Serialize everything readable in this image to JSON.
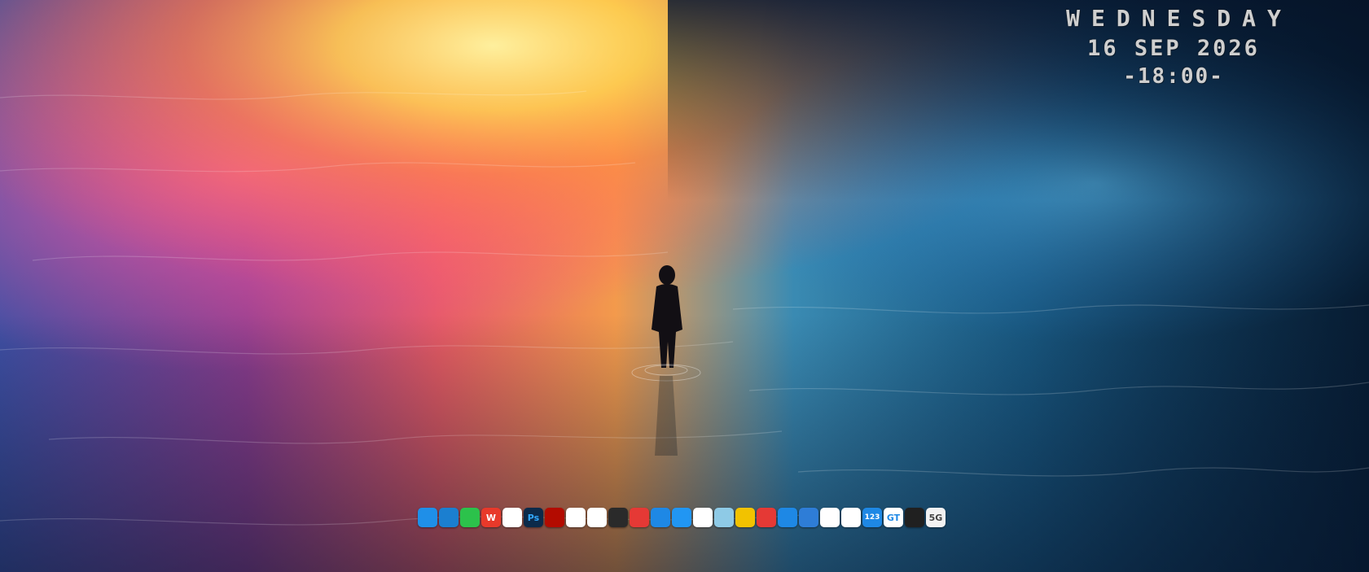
{
  "clock": {
    "day": "WEDNESDAY",
    "date": "16 SEP 2026",
    "time": "-18:00-"
  },
  "dock": {
    "icons": [
      {
        "name": "windows-start-icon",
        "glyph": "",
        "bg": "#1f8fe8",
        "fg": "#ffffff"
      },
      {
        "name": "edge-browser-icon",
        "glyph": "",
        "bg": "#1b7fd0",
        "fg": "#ffffff"
      },
      {
        "name": "wechat-icon",
        "glyph": "",
        "bg": "#2cc24b",
        "fg": "#ffffff"
      },
      {
        "name": "wps-office-icon",
        "glyph": "W",
        "bg": "#e8392a",
        "fg": "#ffffff"
      },
      {
        "name": "qq-penguin-icon",
        "glyph": "",
        "bg": "#ffffff",
        "fg": "#111111"
      },
      {
        "name": "photoshop-icon",
        "glyph": "Ps",
        "bg": "#0c2a4a",
        "fg": "#31a8ff"
      },
      {
        "name": "acrobat-pdf-icon",
        "glyph": "",
        "bg": "#b30b00",
        "fg": "#ffffff"
      },
      {
        "name": "vpn-shield-icon",
        "glyph": "",
        "bg": "#ffffff",
        "fg": "#1a3b7a"
      },
      {
        "name": "launcher-app-icon",
        "glyph": "",
        "bg": "#ffffff",
        "fg": "#111111"
      },
      {
        "name": "media-player-icon",
        "glyph": "",
        "bg": "#2a2a2a",
        "fg": "#f5a623"
      },
      {
        "name": "pdf-reader-icon",
        "glyph": "",
        "bg": "#e53935",
        "fg": "#ffffff"
      },
      {
        "name": "feishu-lark-icon",
        "glyph": "",
        "bg": "#1e88e5",
        "fg": "#ffffff"
      },
      {
        "name": "meta-infinity-icon",
        "glyph": "",
        "bg": "#2196f3",
        "fg": "#ffffff"
      },
      {
        "name": "bilibili-b-icon",
        "glyph": "",
        "bg": "#ffffff",
        "fg": "#111111"
      },
      {
        "name": "notepad-icon",
        "glyph": "",
        "bg": "#8ecae6",
        "fg": "#1d3557"
      },
      {
        "name": "music-note-icon",
        "glyph": "",
        "bg": "#f2c200",
        "fg": "#3a7d1e"
      },
      {
        "name": "netease-music-icon",
        "glyph": "",
        "bg": "#e53935",
        "fg": "#ffffff"
      },
      {
        "name": "refresh-arrow-icon",
        "glyph": "",
        "bg": "#1e88e5",
        "fg": "#ffffff"
      },
      {
        "name": "paper-plane-icon",
        "glyph": "",
        "bg": "#2e7dd7",
        "fg": "#ffffff"
      },
      {
        "name": "baidu-netdisk-icon",
        "glyph": "",
        "bg": "#ffffff",
        "fg": "#1e88e5"
      },
      {
        "name": "cloud-drive-icon",
        "glyph": "",
        "bg": "#ffffff",
        "fg": "#1e88e5"
      },
      {
        "name": "drive-123-icon",
        "glyph": "123",
        "bg": "#1e88e5",
        "fg": "#ffffff"
      },
      {
        "name": "gt-app-icon",
        "glyph": "GT",
        "bg": "#ffffff",
        "fg": "#1e88e5"
      },
      {
        "name": "record-button-icon",
        "glyph": "",
        "bg": "#202020",
        "fg": "#e53935"
      },
      {
        "name": "monitor-screen-icon",
        "glyph": "5G",
        "bg": "#f2f2f2",
        "fg": "#444444"
      }
    ]
  }
}
